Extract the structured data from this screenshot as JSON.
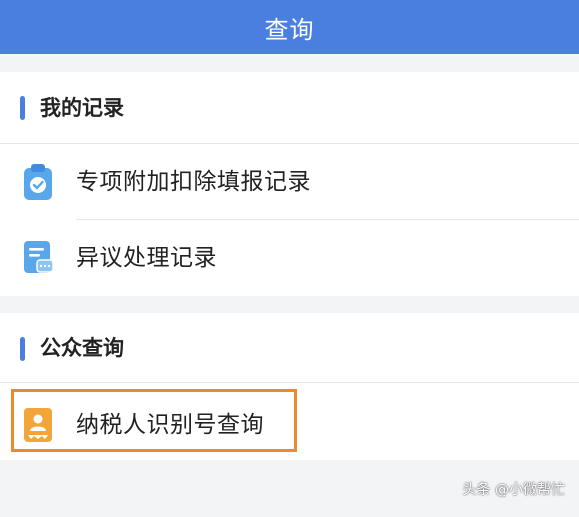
{
  "header": {
    "title": "查询"
  },
  "sections": [
    {
      "title": "我的记录",
      "items": [
        {
          "label": "专项附加扣除填报记录",
          "icon": "clipboard-check-icon"
        },
        {
          "label": "异议处理记录",
          "icon": "document-chat-icon"
        }
      ]
    },
    {
      "title": "公众查询",
      "items": [
        {
          "label": "纳税人识别号查询",
          "icon": "id-badge-icon",
          "highlighted": true
        }
      ]
    }
  ],
  "watermark": "头条 @小微帮忙",
  "colors": {
    "accent": "#4a7fe0",
    "highlight": "#ec8a2c",
    "icon_blue": "#5aa6ea",
    "icon_orange": "#f2a63a"
  }
}
